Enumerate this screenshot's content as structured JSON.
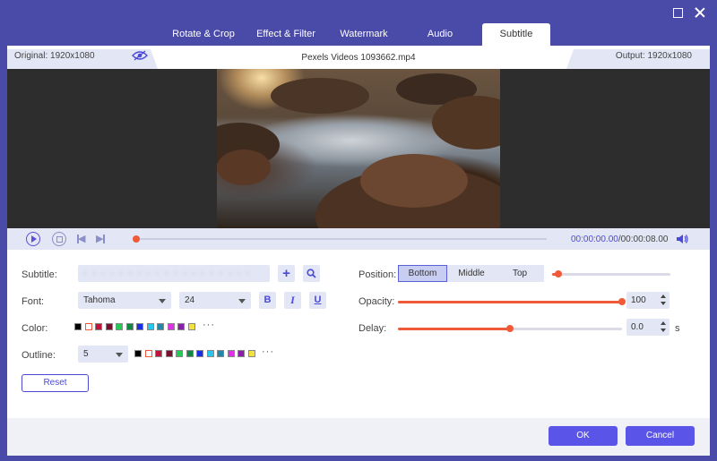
{
  "tabs": [
    {
      "label": "Rotate & Crop",
      "active": false
    },
    {
      "label": "Effect & Filter",
      "active": false
    },
    {
      "label": "Watermark",
      "active": false
    },
    {
      "label": "Audio",
      "active": false
    },
    {
      "label": "Subtitle",
      "active": true
    }
  ],
  "info": {
    "original": "Original: 1920x1080",
    "filename": "Pexels Videos 1093662.mp4",
    "output": "Output: 1920x1080"
  },
  "playback": {
    "current_time": "00:00:00.00",
    "separator": "/",
    "total_time": "00:00:08.00",
    "progress": 0
  },
  "subtitle": {
    "label": "Subtitle:",
    "value": "·  ·  ·  ·  ·  ·  ·  ·  ·  ·  ·  ·  ·  ·  ·  ·  ·  ·  ·",
    "add_icon": "plus-icon",
    "search_icon": "search-icon"
  },
  "font": {
    "label": "Font:",
    "family": "Tahoma",
    "size": "24",
    "bold": "B",
    "italic": "I",
    "underline": "U"
  },
  "color": {
    "label": "Color:",
    "swatches": [
      "#000000",
      "#ffffff",
      "#c0143c",
      "#7a1030",
      "#22cc55",
      "#118844",
      "#1a2ee8",
      "#22c8f0",
      "#2288aa",
      "#e030e8",
      "#8a20a8",
      "#f4e040"
    ],
    "more": "···"
  },
  "outline": {
    "label": "Outline:",
    "value": "5",
    "swatches": [
      "#000000",
      "#ffffff",
      "#c0143c",
      "#7a1030",
      "#22cc55",
      "#118844",
      "#1a2ee8",
      "#22c8f0",
      "#2288aa",
      "#e030e8",
      "#8a20a8",
      "#f4e040"
    ],
    "more": "···"
  },
  "reset_label": "Reset",
  "position": {
    "label": "Position:",
    "options": [
      "Bottom",
      "Middle",
      "Top"
    ],
    "selected": "Bottom",
    "offset_fraction": 0.05
  },
  "opacity": {
    "label": "Opacity:",
    "value": "100",
    "fraction": 1.0
  },
  "delay": {
    "label": "Delay:",
    "value": "0.0",
    "unit": "s",
    "fraction": 0.5
  },
  "footer": {
    "ok_label": "OK",
    "cancel_label": "Cancel"
  },
  "colors": {
    "accent": "#5a55e8",
    "slider": "#f15a38",
    "background": "#4a4aa8"
  }
}
